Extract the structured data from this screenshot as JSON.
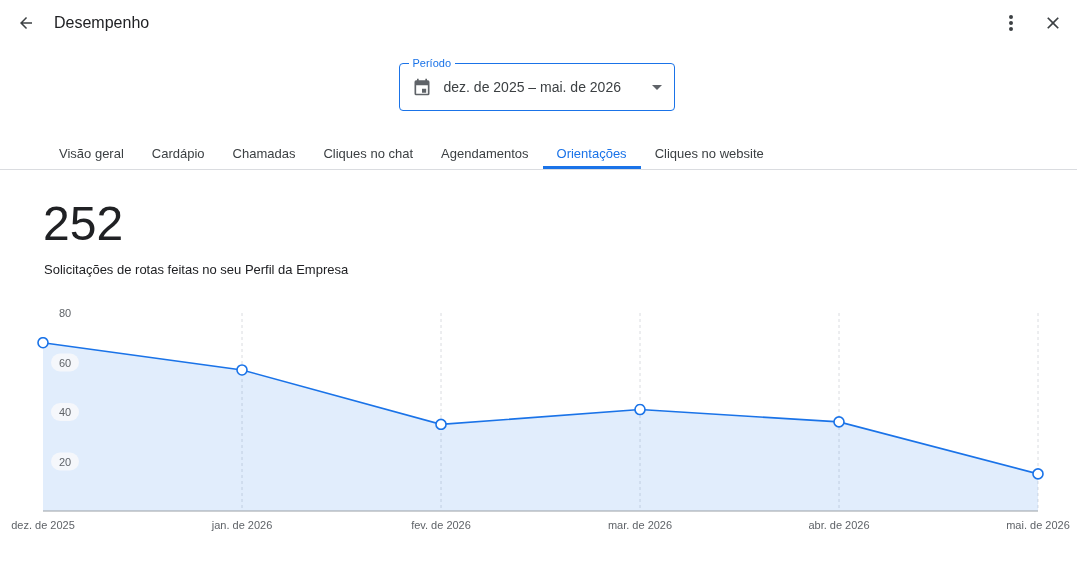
{
  "header": {
    "title": "Desempenho"
  },
  "period": {
    "label": "Período",
    "value": "dez. de 2025 – mai. de 2026"
  },
  "tabs": [
    {
      "label": "Visão geral",
      "selected": false
    },
    {
      "label": "Cardápio",
      "selected": false
    },
    {
      "label": "Chamadas",
      "selected": false
    },
    {
      "label": "Cliques no chat",
      "selected": false
    },
    {
      "label": "Agendamentos",
      "selected": false
    },
    {
      "label": "Orientações",
      "selected": true
    },
    {
      "label": "Cliques no website",
      "selected": false
    }
  ],
  "summary": {
    "total": "252",
    "description": "Solicitações de rotas feitas no seu Perfil da Empresa"
  },
  "chart_data": {
    "type": "area",
    "categories": [
      "dez. de 2025",
      "jan. de 2026",
      "fev. de 2026",
      "mar. de 2026",
      "abr. de 2026",
      "mai. de 2026"
    ],
    "series": [
      {
        "color": "#1a73e8",
        "values": [
          68,
          57,
          35,
          41,
          36,
          15
        ]
      }
    ],
    "ylim": [
      0,
      80
    ],
    "grid": true,
    "yticks": [
      20,
      40,
      60,
      80
    ]
  }
}
